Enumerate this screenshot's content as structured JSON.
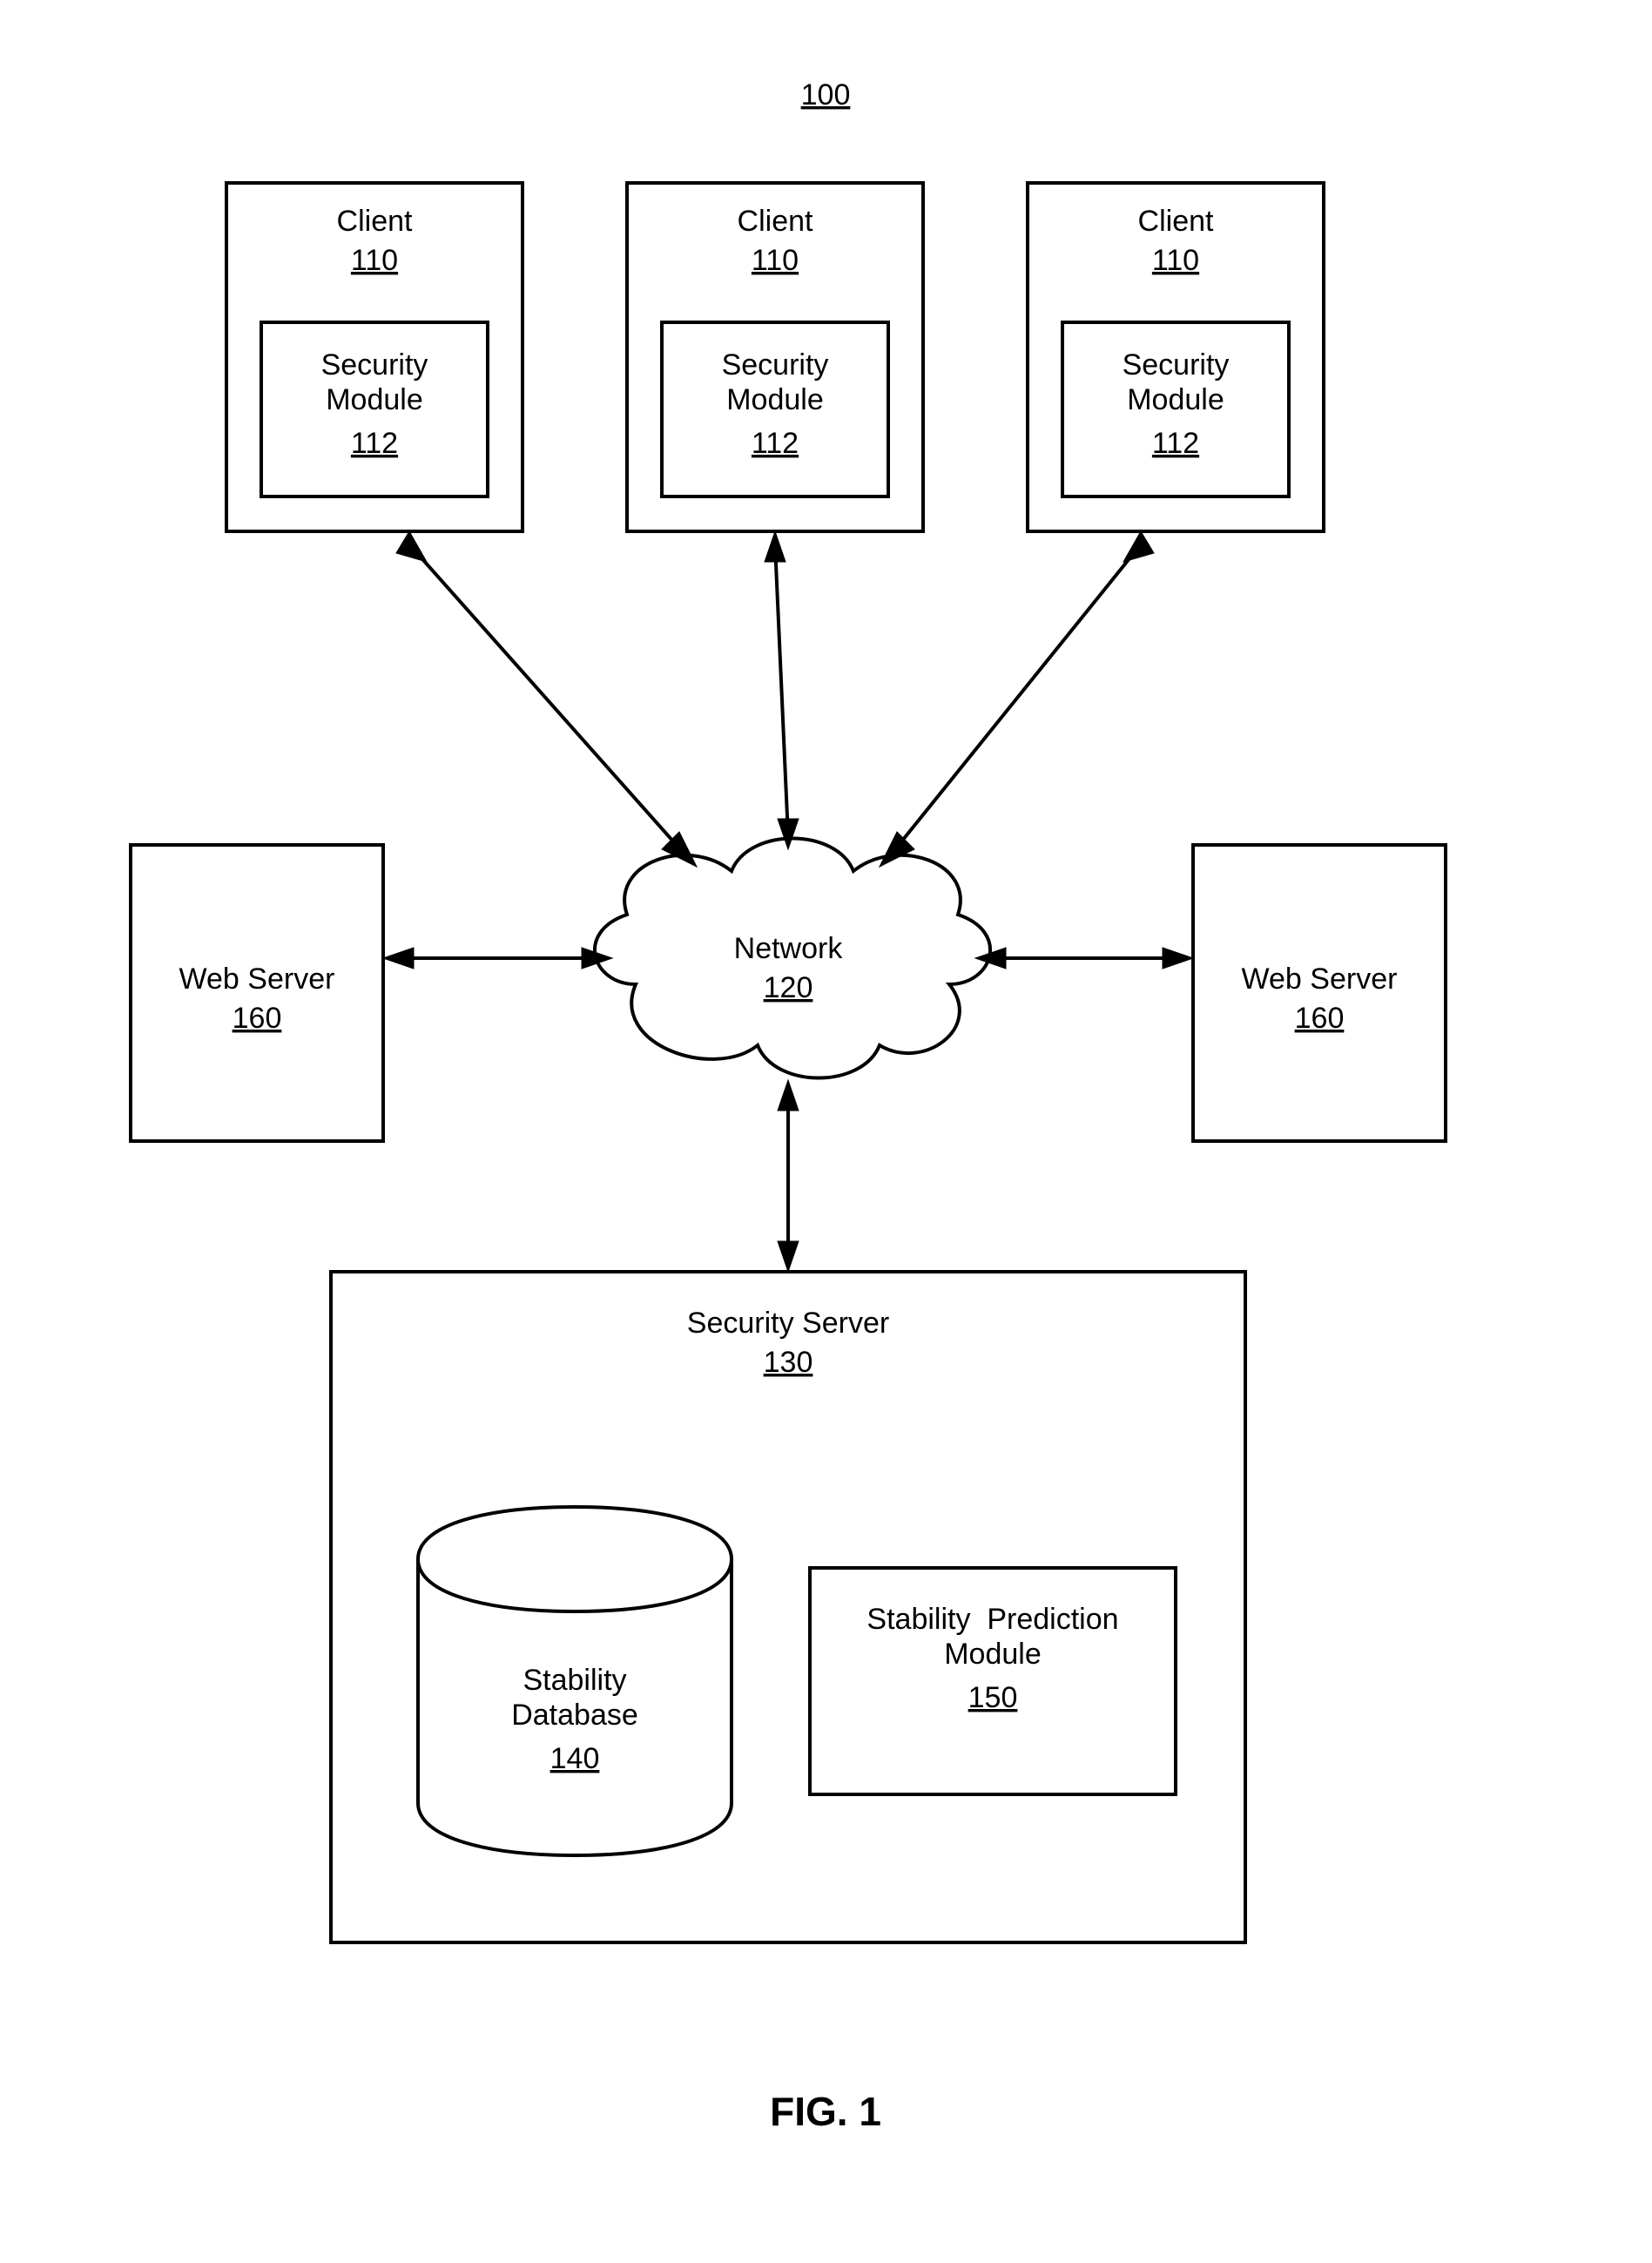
{
  "figure": {
    "title_ref": "100",
    "caption": "FIG. 1"
  },
  "clients": [
    {
      "label": "Client",
      "ref": "110",
      "module_label": "Security\nModule",
      "module_ref": "112"
    },
    {
      "label": "Client",
      "ref": "110",
      "module_label": "Security\nModule",
      "module_ref": "112"
    },
    {
      "label": "Client",
      "ref": "110",
      "module_label": "Security\nModule",
      "module_ref": "112"
    }
  ],
  "network": {
    "label": "Network",
    "ref": "120"
  },
  "web_servers": [
    {
      "label": "Web Server",
      "ref": "160"
    },
    {
      "label": "Web Server",
      "ref": "160"
    }
  ],
  "security_server": {
    "label": "Security Server",
    "ref": "130",
    "database": {
      "label": "Stability\nDatabase",
      "ref": "140"
    },
    "prediction": {
      "label": "Stability  Prediction\nModule",
      "ref": "150"
    }
  }
}
